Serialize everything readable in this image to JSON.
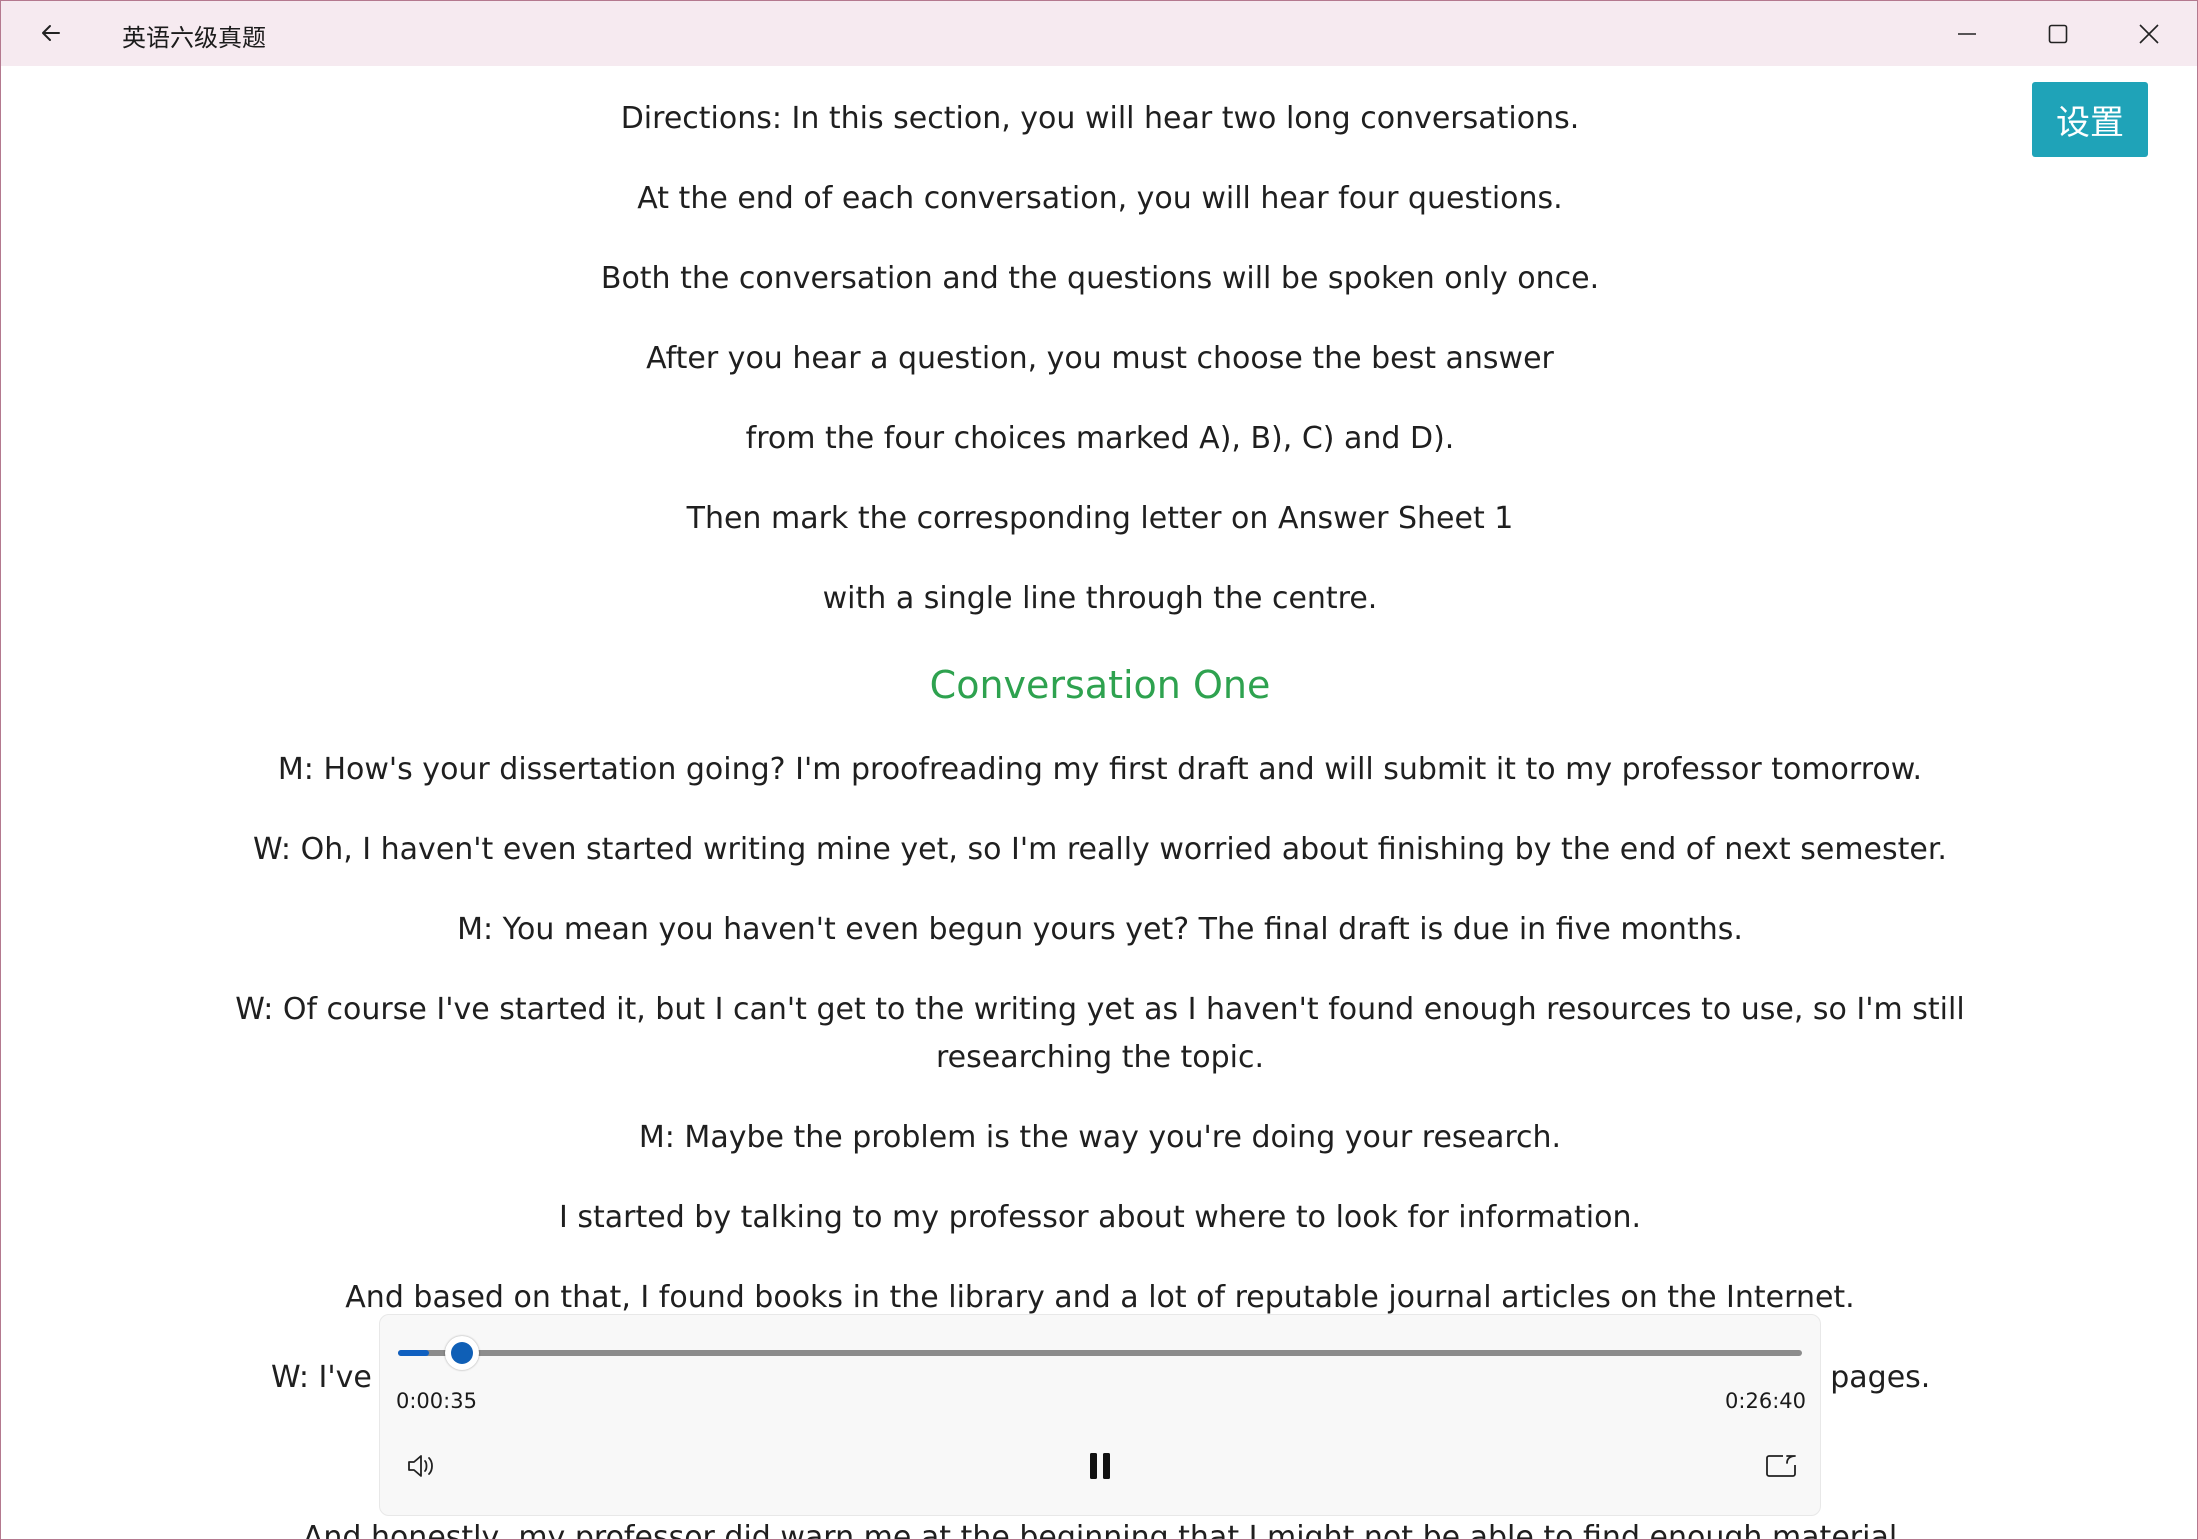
{
  "window": {
    "title": "英语六级真题"
  },
  "settings_label": "设置",
  "transcript": [
    "Directions: In this section, you will hear two long conversations.",
    "At the end of each conversation, you will hear four questions.",
    "Both the conversation and the questions will be spoken only once.",
    "After you hear a question, you must choose the best answer",
    "from the four choices marked A), B), C) and D).",
    "Then mark the corresponding letter on Answer Sheet 1",
    "with a single line through the centre.",
    "Conversation One",
    "M: How's your dissertation going? I'm proofreading my first draft and will submit it to my professor tomorrow.",
    "W: Oh, I haven't even started writing mine yet, so I'm really worried about finishing by the end of next semester.",
    "M: You mean you haven't even begun yours yet? The final draft is due in five months.",
    "W: Of course I've started it, but I can't get to the writing yet as I haven't found enough resources to use, so I'm still researching the topic.",
    "M: Maybe the problem is the way you're doing your research.",
    "I started by talking to my professor about where to look for information.",
    "And based on that, I found books in the library and a lot of reputable journal articles on the Internet.",
    "W: I've t",
    ") pages.",
    "And honestly, my professor did warn me at the beginning that I might not be able to find enough material"
  ],
  "player": {
    "current_time": "0:00:35",
    "total_time": "0:26:40",
    "progress_fraction": 0.022,
    "accent_color": "#0f5fb6",
    "controls": [
      "volume-icon",
      "pause-icon",
      "cast-icon"
    ]
  },
  "colors": {
    "titlebar_bg": "#f6eaf0",
    "settings_button_bg": "#1fa3b8",
    "heading_color": "#2ea24f",
    "window_border": "#b4798f"
  }
}
